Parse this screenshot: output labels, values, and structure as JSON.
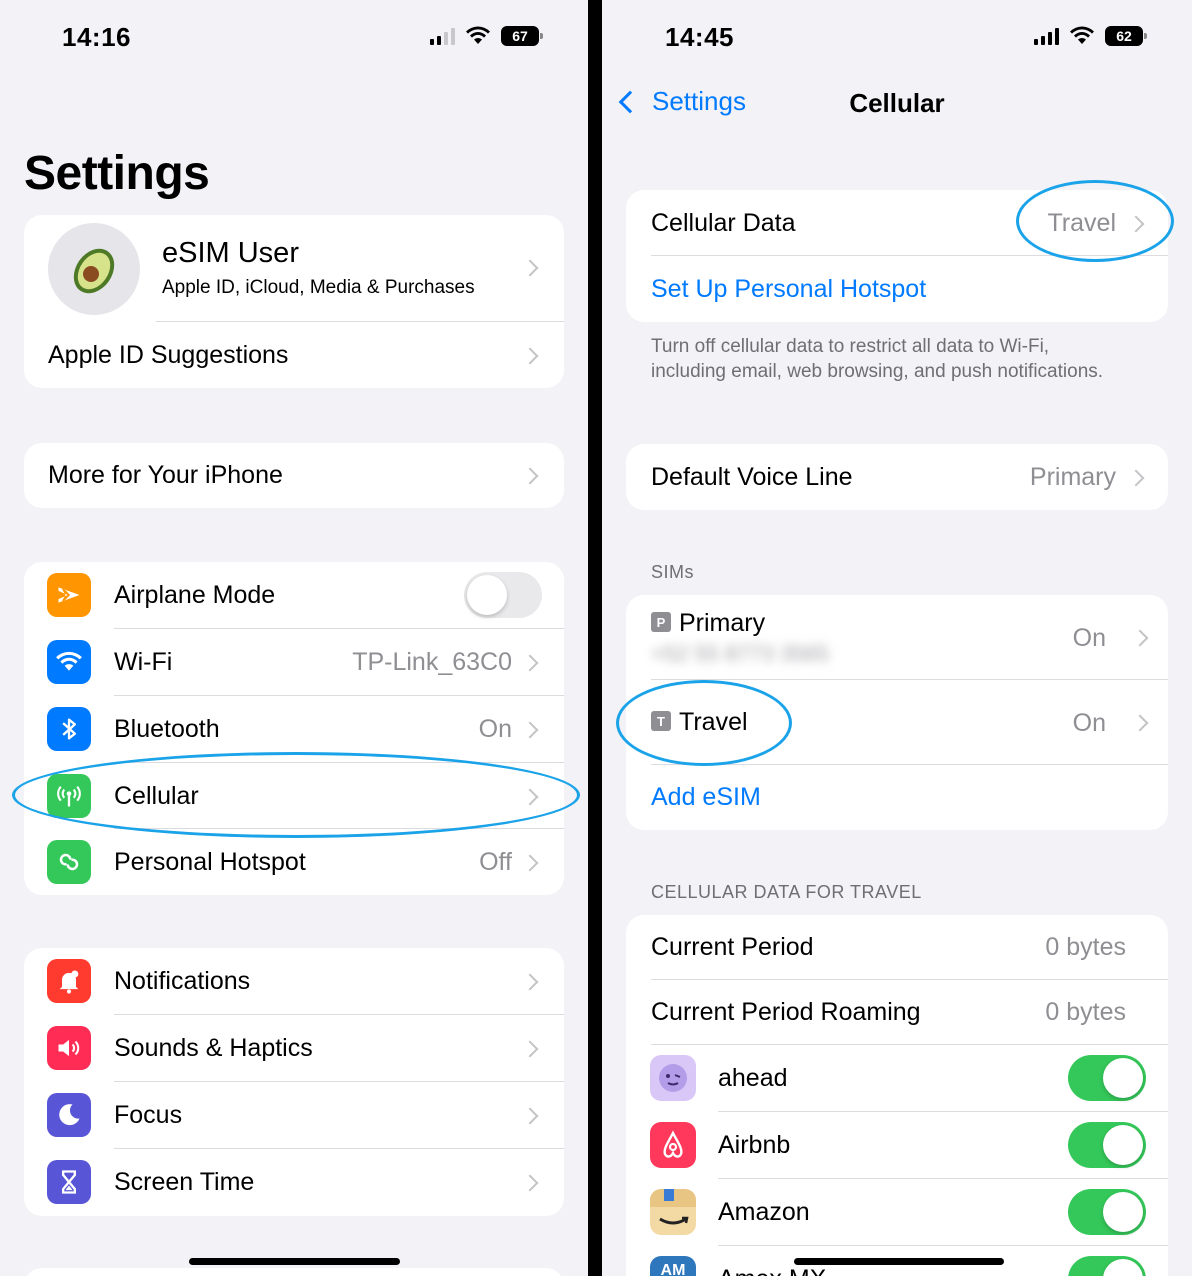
{
  "left": {
    "status": {
      "time": "14:16",
      "battery": "67"
    },
    "title": "Settings",
    "profile": {
      "name": "eSIM User",
      "subtitle": "Apple ID, iCloud, Media & Purchases"
    },
    "apple_id_suggestions": "Apple ID Suggestions",
    "more_for_iphone": "More for Your iPhone",
    "connectivity": [
      {
        "label": "Airplane Mode",
        "value": "",
        "icon": "airplane-icon",
        "color": "#ff9500"
      },
      {
        "label": "Wi-Fi",
        "value": "TP-Link_63C0",
        "icon": "wifi-icon",
        "color": "#007aff"
      },
      {
        "label": "Bluetooth",
        "value": "On",
        "icon": "bluetooth-icon",
        "color": "#007aff"
      },
      {
        "label": "Cellular",
        "value": "",
        "icon": "antenna-icon",
        "color": "#34c759"
      },
      {
        "label": "Personal Hotspot",
        "value": "Off",
        "icon": "hotspot-icon",
        "color": "#34c759"
      }
    ],
    "system": [
      {
        "label": "Notifications",
        "icon": "bell-icon",
        "color": "#ff3b30"
      },
      {
        "label": "Sounds & Haptics",
        "icon": "speaker-icon",
        "color": "#ff2d55"
      },
      {
        "label": "Focus",
        "icon": "moon-icon",
        "color": "#5856d6"
      },
      {
        "label": "Screen Time",
        "icon": "hourglass-icon",
        "color": "#5856d6"
      }
    ]
  },
  "right": {
    "status": {
      "time": "14:45",
      "battery": "62"
    },
    "nav": {
      "back": "Settings",
      "title": "Cellular"
    },
    "cellular_data": {
      "label": "Cellular Data",
      "value": "Travel"
    },
    "hotspot_link": "Set Up Personal Hotspot",
    "footnote": "Turn off cellular data to restrict all data to Wi-Fi, including email, web browsing, and push notifications.",
    "voice_line": {
      "label": "Default Voice Line",
      "value": "Primary"
    },
    "sims_header": "SIMs",
    "sims": [
      {
        "badge": "P",
        "label": "Primary",
        "value": "On",
        "number": "+52 55 8773 3565"
      },
      {
        "badge": "T",
        "label": "Travel",
        "value": "On"
      }
    ],
    "add_esim": "Add eSIM",
    "data_header": "CELLULAR DATA FOR TRAVEL",
    "usage": [
      {
        "label": "Current Period",
        "value": "0 bytes"
      },
      {
        "label": "Current Period Roaming",
        "value": "0 bytes"
      }
    ],
    "apps": [
      {
        "label": "ahead",
        "icon": "ahead-app-icon",
        "color": "#d9c8f7",
        "on": true
      },
      {
        "label": "Airbnb",
        "icon": "airbnb-app-icon",
        "color": "#ff385c",
        "on": true
      },
      {
        "label": "Amazon",
        "icon": "amazon-app-icon",
        "color": "#f3d9a4",
        "on": true
      },
      {
        "label": "Amex MX",
        "icon": "amex-app-icon",
        "color": "#2e77bc",
        "icon_text": "AM",
        "on": true
      }
    ]
  },
  "accent": "#007aff",
  "highlight_color": "#1aa3e8"
}
